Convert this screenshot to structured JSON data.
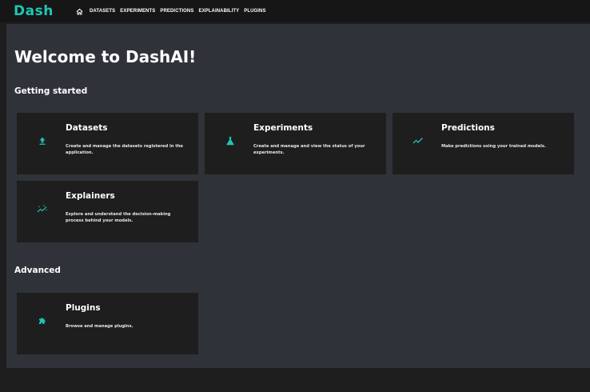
{
  "logo": {
    "text": "Dash"
  },
  "nav": {
    "items": [
      "DATASETS",
      "EXPERIMENTS",
      "PREDICTIONS",
      "EXPLAINABILITY",
      "PLUGINS"
    ]
  },
  "main": {
    "welcome": "Welcome to DashAI!",
    "getting_started": "Getting started",
    "advanced": "Advanced",
    "cards": [
      {
        "title": "Datasets",
        "desc": "Create and manage the datasets registered in the application.",
        "icon": "upload-icon"
      },
      {
        "title": "Experiments",
        "desc": "Create and manage and view the status of your experiments.",
        "icon": "flask-icon"
      },
      {
        "title": "Predictions",
        "desc": "Make predictions using your trained models.",
        "icon": "trending-up-icon"
      },
      {
        "title": "Explainers",
        "desc": "Explore and understand the decision-making process behind your models.",
        "icon": "insights-icon"
      },
      {
        "title": "Plugins",
        "desc": "Browse and manage plugins.",
        "icon": "puzzle-icon"
      }
    ]
  },
  "colors": {
    "accent": "#21c4b5",
    "background": "#30323a",
    "card": "#1e1e1e",
    "topbar": "#161616"
  }
}
